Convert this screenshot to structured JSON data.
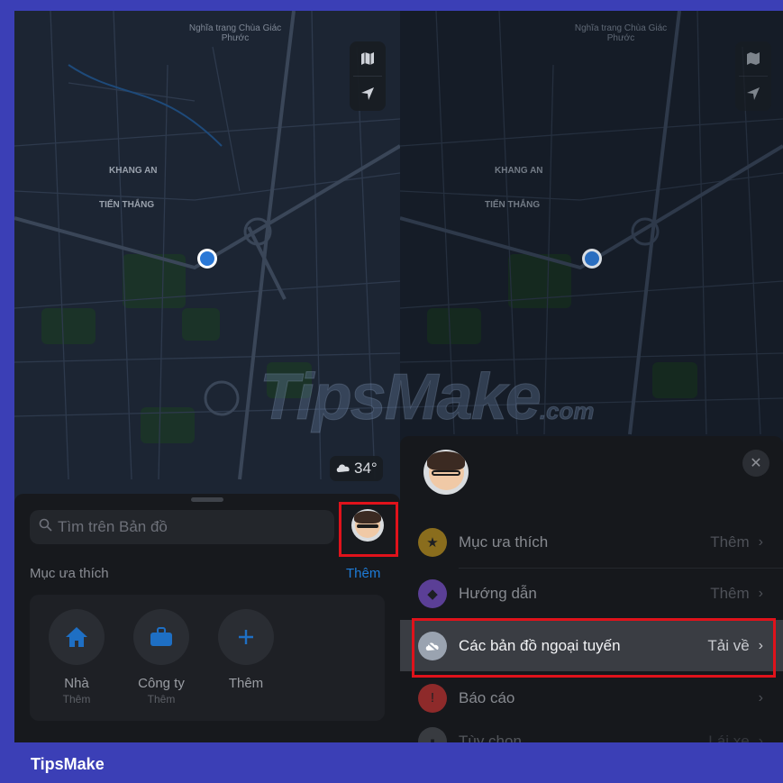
{
  "left": {
    "map_labels": [
      "Nghĩa trang Chùa Giác Phước",
      "KHANG AN",
      "TIẾN THẮNG"
    ],
    "map_button_icons": [
      "map-icon",
      "location-arrow-icon"
    ],
    "weather": {
      "icon": "cloud-icon",
      "text": "34°"
    },
    "search": {
      "placeholder": "Tìm trên Bản đồ",
      "icon": "search-icon"
    },
    "favorites": {
      "title": "Mục ưa thích",
      "more": "Thêm",
      "items": [
        {
          "label": "Nhà",
          "sub": "Thêm",
          "icon": "home-icon"
        },
        {
          "label": "Công ty",
          "sub": "Thêm",
          "icon": "briefcase-icon"
        },
        {
          "label": "Thêm",
          "sub": "",
          "icon": "plus-icon"
        }
      ]
    }
  },
  "right": {
    "map_labels": [
      "Nghĩa trang Chùa Giác Phước",
      "KHANG AN",
      "TIẾN THẮNG"
    ],
    "close_icon": "close-icon",
    "menu": [
      {
        "label": "Mục ưa thích",
        "value": "Thêm",
        "icon": "star-icon",
        "color": "#c9a227"
      },
      {
        "label": "Hướng dẫn",
        "value": "Thêm",
        "icon": "guide-icon",
        "color": "#8a63d2"
      },
      {
        "label": "Các bản đồ ngoại tuyến",
        "value": "Tải về",
        "icon": "cloud-offline-icon",
        "color": "#9aa3b0"
      },
      {
        "label": "Báo cáo",
        "value": "",
        "icon": "report-icon",
        "color": "#d23b3b"
      },
      {
        "label": "Tùy chọn",
        "value": "Lái xe",
        "icon": "car-icon",
        "color": "#8d9097"
      }
    ]
  },
  "watermark": {
    "text": "TipsMake",
    "domain": ".com"
  },
  "footer": {
    "brand": "TipsMake"
  },
  "colors": {
    "frame": "#3b3fb6",
    "highlight": "#e0121b",
    "accent": "#1e7cd8"
  }
}
